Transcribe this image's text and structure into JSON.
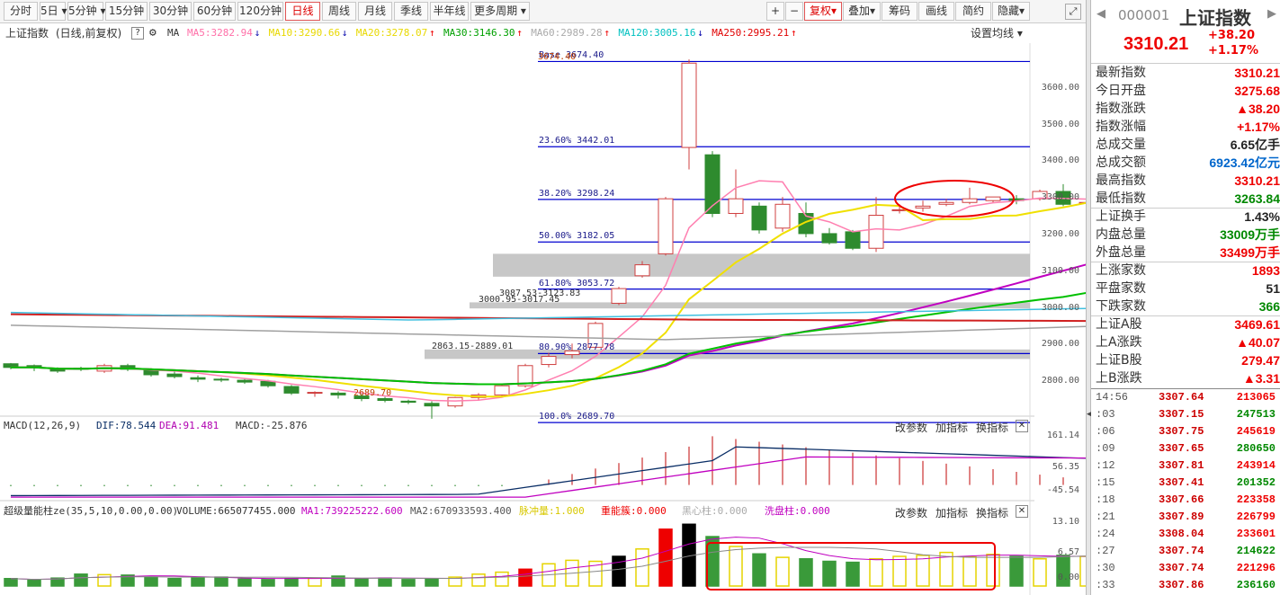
{
  "toolbar": {
    "left": [
      "分时",
      "5日",
      "5分钟",
      "15分钟",
      "30分钟",
      "60分钟",
      "120分钟",
      "日线",
      "周线",
      "月线",
      "季线",
      "半年线",
      "更多周期"
    ],
    "right": [
      "+",
      "−",
      "复权",
      "叠加",
      "筹码",
      "画线",
      "简约",
      "隐藏"
    ],
    "active": "日线"
  },
  "title": {
    "name": "上证指数",
    "mode": "(日线,前复权)",
    "ma": "MA",
    "setting": "设置均线"
  },
  "ma_items": [
    {
      "label": "MA5:3282.94",
      "color": "#ff6fa8",
      "arrow": "↓"
    },
    {
      "label": "MA10:3290.66",
      "color": "#e8d800",
      "arrow": "↓"
    },
    {
      "label": "MA20:3278.07",
      "color": "#e8d800",
      "arrow": "↑"
    },
    {
      "label": "MA30:3146.30",
      "color": "#00a000",
      "arrow": "↑"
    },
    {
      "label": "MA60:2989.28",
      "color": "#aaa",
      "arrow": "↑"
    },
    {
      "label": "MA120:3005.16",
      "color": "#00c0c0",
      "arrow": "↓"
    },
    {
      "label": "MA250:2995.21",
      "color": "#e00000",
      "arrow": "↑"
    }
  ],
  "price_axis": [
    "3600.00",
    "3500.00",
    "3400.00",
    "3300.00",
    "3200.00",
    "3100.00",
    "3000.00",
    "2900.00",
    "2800.00"
  ],
  "fib": [
    {
      "label": "Base  3674.40",
      "v": 3674.4
    },
    {
      "label": "23.60% 3442.01",
      "v": 3442.01
    },
    {
      "label": "38.20% 3298.24",
      "v": 3298.24
    },
    {
      "label": "50.00% 3182.05",
      "v": 3182.05
    },
    {
      "label": "61.80% 3053.72",
      "v": 3053.72
    },
    {
      "label": "80.90% 2877.78",
      "v": 2877.78
    },
    {
      "label": "100.0% 2689.70",
      "v": 2689.7
    }
  ],
  "annotations": {
    "high": "3674.40",
    "low": "2689.70",
    "gap1": "3087.53-3123.83",
    "gap2": "3000.95-3017.45",
    "gap3": "2863.15-2889.01"
  },
  "macd": {
    "header": "MACD(12,26,9)",
    "dif": "DIF:78.544",
    "dea": "DEA:91.481",
    "macd": "MACD:-25.876",
    "axis": [
      "161.14",
      "56.35",
      "-45.54"
    ]
  },
  "vol": {
    "header": "超级量能柱ze(35,5,10,0.00,0.00)",
    "volume": "VOLUME:665077455.000",
    "ma1": "MA1:739225222.600",
    "ma2": "MA2:670933593.400",
    "pulse": "脉冲量:1.000",
    "zone": "重能簇:0.000",
    "black": "黑心柱:0.000",
    "wash": "洗盘柱:0.000",
    "axis": [
      "13.10",
      "6.57",
      "0.00"
    ]
  },
  "panel_actions": [
    "改参数",
    "加指标",
    "换指标"
  ],
  "quote": {
    "code": "000001",
    "name": "上证指数",
    "price": "3310.21",
    "change": "+38.20",
    "pct": "+1.17%",
    "stats": [
      {
        "k": "最新指数",
        "v": "3310.21",
        "c": "red"
      },
      {
        "k": "今日开盘",
        "v": "3275.68",
        "c": "red"
      },
      {
        "k": "指数涨跌",
        "v": "▲38.20",
        "c": "red"
      },
      {
        "k": "指数涨幅",
        "v": "+1.17%",
        "c": "red"
      },
      {
        "k": "总成交量",
        "v": "6.65亿手",
        "c": "dark"
      },
      {
        "k": "总成交额",
        "v": "6923.42亿元",
        "c": "blue"
      },
      {
        "k": "最高指数",
        "v": "3310.21",
        "c": "red"
      },
      {
        "k": "最低指数",
        "v": "3263.84",
        "c": "green"
      },
      {
        "k": "上证换手",
        "v": "1.43%",
        "c": "dark"
      },
      {
        "k": "内盘总量",
        "v": "33009万手",
        "c": "green"
      },
      {
        "k": "外盘总量",
        "v": "33499万手",
        "c": "red"
      },
      {
        "k": "上涨家数",
        "v": "1893",
        "c": "red"
      },
      {
        "k": "平盘家数",
        "v": "51",
        "c": "dark"
      },
      {
        "k": "下跌家数",
        "v": "366",
        "c": "green"
      },
      {
        "k": "上证A股",
        "v": "3469.61",
        "c": "red"
      },
      {
        "k": "上A涨跌",
        "v": "▲40.07",
        "c": "red"
      },
      {
        "k": "上证B股",
        "v": "279.47",
        "c": "red"
      },
      {
        "k": "上B涨跌",
        "v": "▲3.31",
        "c": "red"
      }
    ],
    "ticks": [
      {
        "t": "14:56",
        "p": "3307.64",
        "q": "213065",
        "c": "red"
      },
      {
        "t": ":03",
        "p": "3307.15",
        "q": "247513",
        "c": "green"
      },
      {
        "t": ":06",
        "p": "3307.75",
        "q": "245619",
        "c": "red"
      },
      {
        "t": ":09",
        "p": "3307.65",
        "q": "280650",
        "c": "green"
      },
      {
        "t": ":12",
        "p": "3307.81",
        "q": "243914",
        "c": "red"
      },
      {
        "t": ":15",
        "p": "3307.41",
        "q": "201352",
        "c": "green"
      },
      {
        "t": ":18",
        "p": "3307.66",
        "q": "223358",
        "c": "red"
      },
      {
        "t": ":21",
        "p": "3307.89",
        "q": "226799",
        "c": "red"
      },
      {
        "t": ":24",
        "p": "3308.04",
        "q": "233601",
        "c": "red"
      },
      {
        "t": ":27",
        "p": "3307.74",
        "q": "214622",
        "c": "green"
      },
      {
        "t": ":30",
        "p": "3307.74",
        "q": "221296",
        "c": "red"
      },
      {
        "t": ":33",
        "p": "3307.86",
        "q": "236160",
        "c": "green"
      }
    ]
  },
  "chart_data": {
    "type": "candlestick",
    "ylim": [
      2690,
      3700
    ],
    "candles": [
      [
        2850,
        2852,
        2840,
        2835
      ],
      [
        2845,
        2848,
        2840,
        2830
      ],
      [
        2835,
        2840,
        2830,
        2825
      ],
      [
        2838,
        2842,
        2835,
        2830
      ],
      [
        2830,
        2850,
        2845,
        2825
      ],
      [
        2845,
        2850,
        2835,
        2830
      ],
      [
        2832,
        2838,
        2820,
        2815
      ],
      [
        2822,
        2830,
        2815,
        2810
      ],
      [
        2812,
        2818,
        2808,
        2800
      ],
      [
        2808,
        2812,
        2806,
        2800
      ],
      [
        2805,
        2810,
        2800,
        2795
      ],
      [
        2802,
        2806,
        2790,
        2785
      ],
      [
        2788,
        2792,
        2770,
        2765
      ],
      [
        2770,
        2775,
        2772,
        2760
      ],
      [
        2770,
        2775,
        2765,
        2755
      ],
      [
        2762,
        2768,
        2755,
        2748
      ],
      [
        2755,
        2760,
        2750,
        2745
      ],
      [
        2748,
        2752,
        2745,
        2740
      ],
      [
        2742,
        2748,
        2735,
        2700
      ],
      [
        2735,
        2760,
        2758,
        2730
      ],
      [
        2758,
        2770,
        2765,
        2750
      ],
      [
        2765,
        2795,
        2790,
        2760
      ],
      [
        2790,
        2850,
        2845,
        2785
      ],
      [
        2848,
        2880,
        2870,
        2840
      ],
      [
        2875,
        2905,
        2885,
        2865
      ],
      [
        2895,
        2965,
        2960,
        2890
      ],
      [
        3015,
        3060,
        3055,
        3010
      ],
      [
        3090,
        3130,
        3120,
        3085
      ],
      [
        3150,
        3305,
        3300,
        3145
      ],
      [
        3440,
        3680,
        3670,
        3380
      ],
      [
        3420,
        3430,
        3260,
        3250
      ],
      [
        3260,
        3380,
        3300,
        3250
      ],
      [
        3280,
        3290,
        3215,
        3205
      ],
      [
        3220,
        3305,
        3285,
        3210
      ],
      [
        3260,
        3290,
        3205,
        3195
      ],
      [
        3205,
        3220,
        3180,
        3175
      ],
      [
        3210,
        3215,
        3165,
        3160
      ],
      [
        3165,
        3305,
        3255,
        3155
      ],
      [
        3270,
        3285,
        3270,
        3260
      ],
      [
        3275,
        3295,
        3280,
        3265
      ],
      [
        3285,
        3300,
        3290,
        3280
      ],
      [
        3290,
        3330,
        3300,
        3285
      ],
      [
        3295,
        3305,
        3305,
        3290
      ],
      [
        3300,
        3310,
        3295,
        3285
      ],
      [
        3300,
        3325,
        3320,
        3295
      ],
      [
        3320,
        3340,
        3285,
        3280
      ],
      [
        3290,
        3300,
        3290,
        3275
      ],
      [
        3285,
        3295,
        3290,
        3280
      ],
      [
        3290,
        3300,
        3285,
        3275
      ],
      [
        3280,
        3295,
        3292,
        3270
      ],
      [
        3275,
        3310,
        3310,
        3264
      ]
    ],
    "volume": [
      1.5,
      1.2,
      1.6,
      2.4,
      2.3,
      2.2,
      1.8,
      1.5,
      1.6,
      1.8,
      1.4,
      1.3,
      1.5,
      1.6,
      2.0,
      1.5,
      1.6,
      1.3,
      1.5,
      1.8,
      2.4,
      2.8,
      3.4,
      4.5,
      5.2,
      5.0,
      6.0,
      7.5,
      11.5,
      12.5,
      10.0,
      8.0,
      6.5,
      5.8,
      5.5,
      5.0,
      4.8,
      5.5,
      6.0,
      6.2,
      6.8,
      5.9,
      6.4,
      6.0,
      5.5,
      6.2,
      6.0,
      6.6,
      7.5,
      8.0,
      6.0
    ]
  }
}
